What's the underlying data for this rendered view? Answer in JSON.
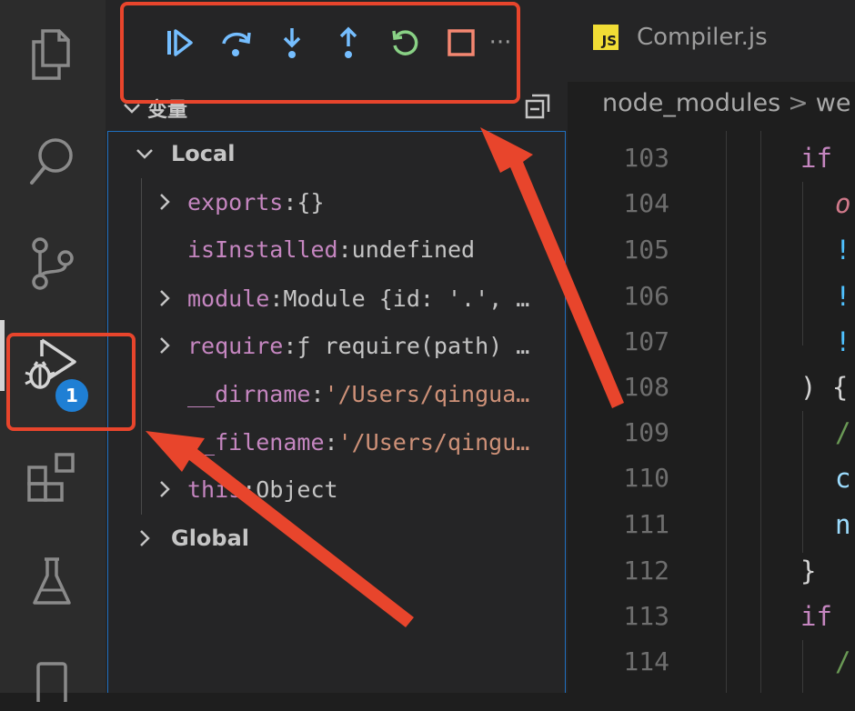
{
  "activity_bar": {
    "items": [
      {
        "name": "explorer-icon"
      },
      {
        "name": "search-icon"
      },
      {
        "name": "source-control-icon"
      },
      {
        "name": "run-debug-icon",
        "active": true,
        "badge": "1"
      },
      {
        "name": "extensions-icon"
      },
      {
        "name": "testing-icon"
      },
      {
        "name": "remote-explorer-icon"
      }
    ]
  },
  "debug_toolbar": {
    "buttons": [
      {
        "name": "continue-icon",
        "color": "#75beff"
      },
      {
        "name": "step-over-icon",
        "color": "#75beff"
      },
      {
        "name": "step-into-icon",
        "color": "#75beff"
      },
      {
        "name": "step-out-icon",
        "color": "#75beff"
      },
      {
        "name": "restart-icon",
        "color": "#89d185"
      },
      {
        "name": "stop-icon",
        "color": "#f48771"
      }
    ],
    "more": "···"
  },
  "variables_section": {
    "title": "变量",
    "scopes": [
      {
        "label": "Local",
        "expanded": true,
        "variables": [
          {
            "name": "exports",
            "value": "{}",
            "expandable": true,
            "is_string": false
          },
          {
            "name": "isInstalled",
            "value": "undefined",
            "expandable": false,
            "is_string": false
          },
          {
            "name": "module",
            "value": "Module {id: '.', …",
            "expandable": true,
            "is_string": false
          },
          {
            "name": "require",
            "value": "ƒ require(path) …",
            "expandable": true,
            "is_string": false
          },
          {
            "name": "__dirname",
            "value": "'/Users/qingua…",
            "expandable": false,
            "is_string": true
          },
          {
            "name": "__filename",
            "value": "'/Users/qingu…",
            "expandable": false,
            "is_string": true
          },
          {
            "name": "this",
            "value": "Object",
            "expandable": true,
            "is_string": false
          }
        ]
      },
      {
        "label": "Global",
        "expanded": false
      }
    ]
  },
  "editor": {
    "tab": {
      "icon": "JS",
      "label": "Compiler.js"
    },
    "breadcrumb": {
      "segment1": "node_modules",
      "separator": ">",
      "segment2": "we"
    },
    "lines": [
      {
        "n": "103",
        "code": "if"
      },
      {
        "n": "104",
        "code": "o"
      },
      {
        "n": "105",
        "code": "!"
      },
      {
        "n": "106",
        "code": "!"
      },
      {
        "n": "107",
        "code": "!"
      },
      {
        "n": "108",
        "code": ") {"
      },
      {
        "n": "109",
        "code": "/"
      },
      {
        "n": "110",
        "code": "c"
      },
      {
        "n": "111",
        "code": "n"
      },
      {
        "n": "112",
        "code": "}"
      },
      {
        "n": "113",
        "code": "if"
      },
      {
        "n": "114",
        "code": "/"
      }
    ]
  },
  "annotation_color": "#e8452c"
}
